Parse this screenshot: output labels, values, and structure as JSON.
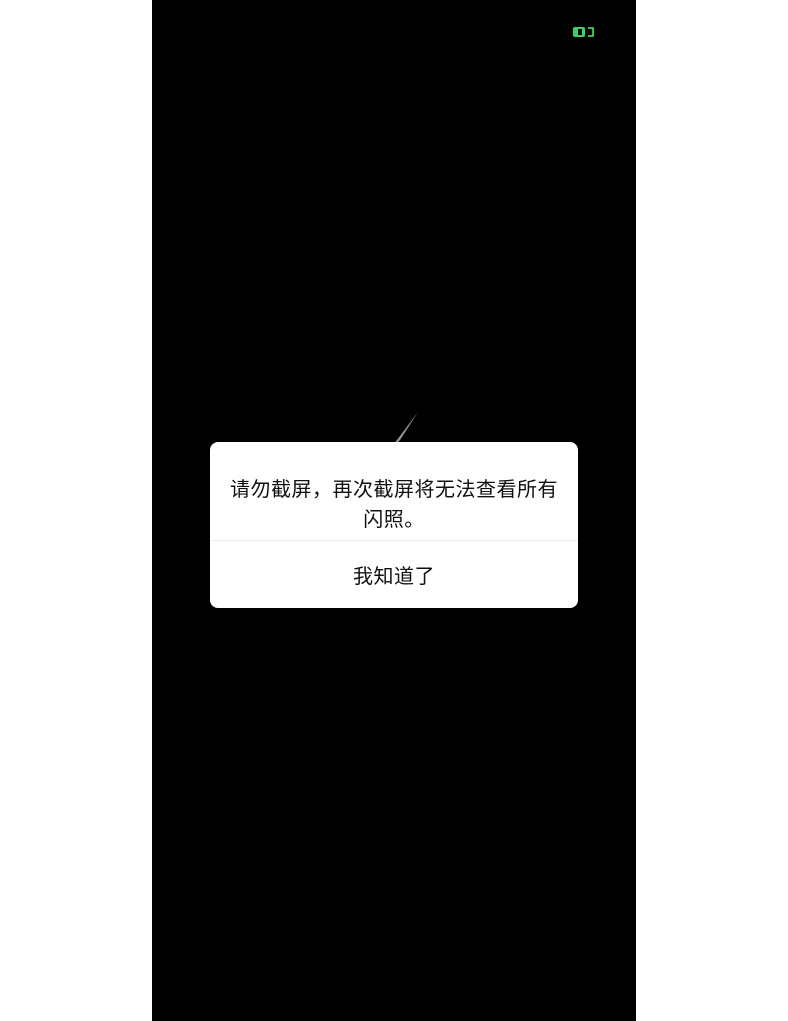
{
  "status_bar": {
    "indicator_icon": "green-camera-icon",
    "indicator_color": "#3ecf5a"
  },
  "background": {
    "pointer_icon": "triangle-pointer-icon",
    "pointer_color": "#9a9a9a"
  },
  "dialog": {
    "message": "请勿截屏，再次截屏将无法查看所有闪照。",
    "button_label": "我知道了"
  },
  "colors": {
    "screen_bg": "#000000",
    "dialog_bg": "#ffffff",
    "text": "#111111"
  }
}
